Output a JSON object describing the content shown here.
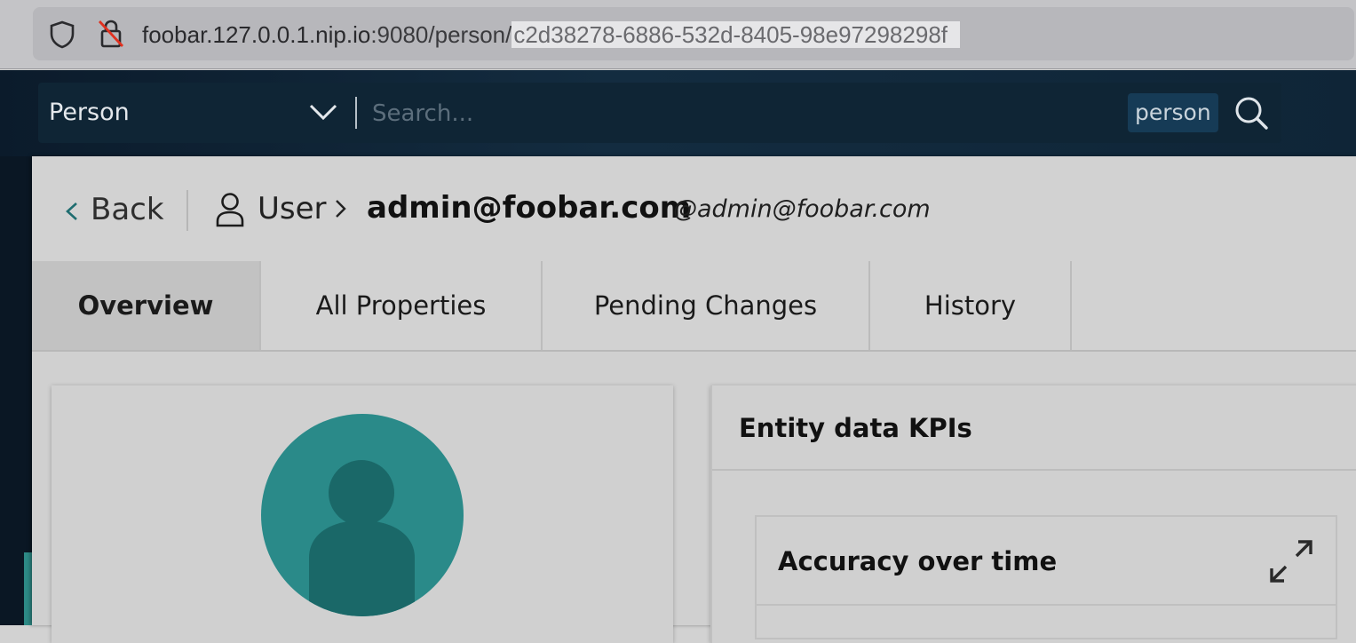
{
  "browser": {
    "url_host": "foobar.127.0.0.1.nip.io",
    "url_port_path": ":9080/person/",
    "url_selected": "c2d38278-6886-532d-8405-98e97298298f",
    "icons": [
      "shield-icon",
      "lock-slash-icon"
    ]
  },
  "search": {
    "type_label": "Person",
    "placeholder": "Search...",
    "tag": "person",
    "icons": [
      "chevron-down-icon",
      "search-icon"
    ]
  },
  "entity": {
    "back_label": "Back",
    "breadcrumb_type": "User",
    "name": "admin@foobar.com",
    "id": "@admin@foobar.com"
  },
  "tabs": [
    {
      "label": "Overview",
      "active": true
    },
    {
      "label": "All Properties",
      "active": false
    },
    {
      "label": "Pending Changes",
      "active": false
    },
    {
      "label": "History",
      "active": false
    }
  ],
  "kpis": {
    "title": "Entity data KPIs",
    "chart_card_title": "Accuracy over time"
  },
  "colors": {
    "header_bg": "#0f2537",
    "accent_teal": "#2a8a89",
    "avatar_silhouette": "#1a6868"
  }
}
